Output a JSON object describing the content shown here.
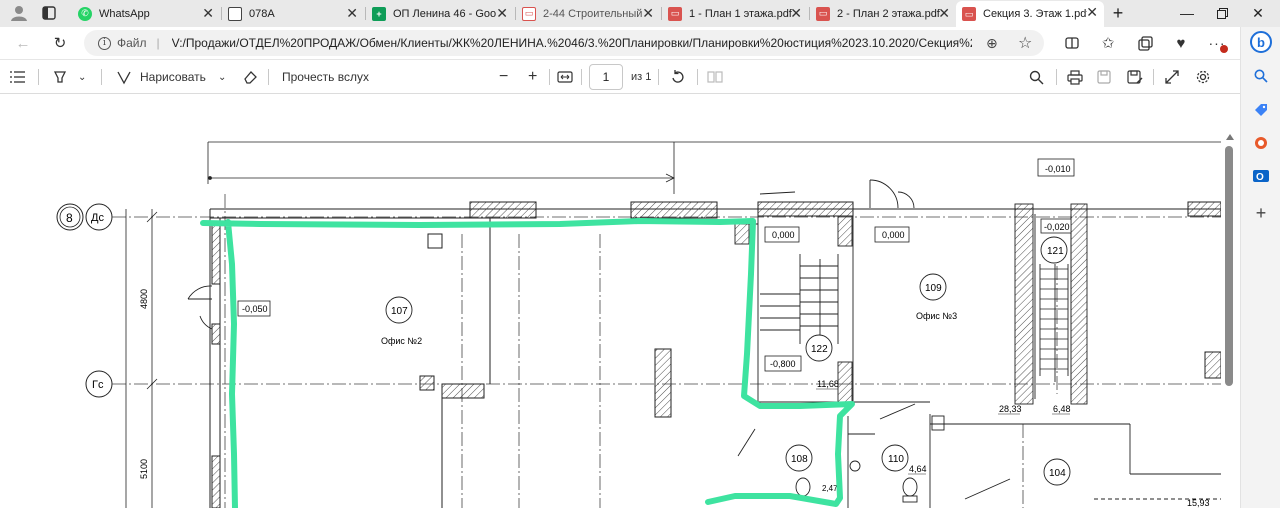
{
  "tabs": [
    {
      "label": "WhatsApp",
      "icon": "whatsapp-icon",
      "color": "#25d366"
    },
    {
      "label": "078A",
      "icon": "document-icon",
      "color": "#555555"
    },
    {
      "label": "ОП Ленина 46 - Goo",
      "icon": "sheets-icon",
      "color": "#0f9d58"
    },
    {
      "label": "2-44 Строительный",
      "icon": "pdf-icon",
      "color": "#d9534f"
    },
    {
      "label": "1 - План 1 этажа.pdf",
      "icon": "pdf-icon",
      "color": "#d9534f"
    },
    {
      "label": "2 - План 2 этажа.pdf",
      "icon": "pdf-icon",
      "color": "#d9534f"
    },
    {
      "label": "Секция 3. Этаж 1.pdf",
      "icon": "pdf-icon",
      "color": "#d9534f",
      "active": true
    }
  ],
  "address": {
    "scheme": "Файл",
    "url": "V:/Продажи/ОТДЕЛ%20ПРОДАЖ/Обмен/Клиенты/ЖК%20ЛЕНИНА.%2046/3.%20Планировки/Планировки%20юстиция%2023.10.2020/Секция%203/С..."
  },
  "pdf_toolbar": {
    "draw_label": "Нарисовать",
    "read_aloud_label": "Прочесть вслух",
    "page_current": "1",
    "page_total": "из 1"
  },
  "plan": {
    "axis_8": "8",
    "axis_ds": "Дс",
    "axis_gs": "Гс",
    "dim_4800": "4800",
    "dim_5100": "5100",
    "level_m050": "-0,050",
    "level_0000_a": "0,000",
    "level_0000_b": "0,000",
    "level_m0010": "-0,010",
    "level_m0020": "-0,020",
    "level_m0800": "-0,800",
    "room_107": "107",
    "office_2": "Офис №2",
    "room_109": "109",
    "office_3": "Офис №3",
    "room_121": "121",
    "room_122": "122",
    "room_108": "108",
    "room_110": "110",
    "room_104": "104",
    "area_1168": "11,68",
    "area_2833": "28,33",
    "area_648": "6,48",
    "area_464": "4,64",
    "area_1593": "15,93",
    "area_247": "2,47",
    "highlight_color": "#3ee3a0"
  }
}
